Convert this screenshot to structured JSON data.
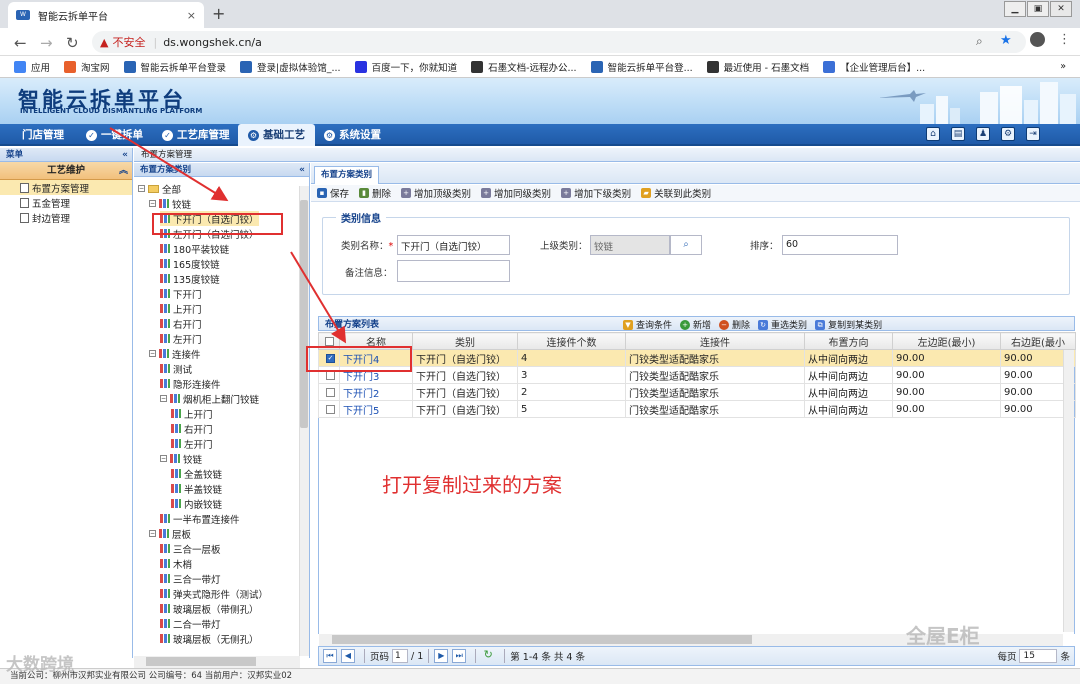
{
  "browser": {
    "tab_title": "智能云拆单平台",
    "tab_close": "×",
    "new_tab": "+",
    "insecure_label": "不安全",
    "url": "ds.wongshek.cn/a",
    "bookmarks": [
      {
        "label": "应用",
        "icon": "apps-icon",
        "color": "#4285f4"
      },
      {
        "label": "淘宝网",
        "icon": "taobao-icon",
        "color": "#e8602c"
      },
      {
        "label": "智能云拆单平台登录",
        "icon": "site-icon",
        "color": "#2a64b4"
      },
      {
        "label": "登录|虚拟体验馆_...",
        "icon": "site-icon",
        "color": "#2a64b4"
      },
      {
        "label": "百度一下，你就知道",
        "icon": "baidu-icon",
        "color": "#2932e1"
      },
      {
        "label": "石墨文档-远程办公...",
        "icon": "shimo-icon",
        "color": "#333333"
      },
      {
        "label": "智能云拆单平台登...",
        "icon": "site-icon",
        "color": "#2a64b4"
      },
      {
        "label": "最近使用 - 石墨文档",
        "icon": "shimo-icon",
        "color": "#333333"
      },
      {
        "label": "【企业管理后台】...",
        "icon": "shield-icon",
        "color": "#3b6fd6"
      }
    ],
    "bookmark_more": "»"
  },
  "app": {
    "title": "智能云拆单平台",
    "subtitle": "INTELLIGENT CLOUD DISMANTLING PLATFORM",
    "nav": [
      "门店管理",
      "一键拆单",
      "工艺库管理",
      "基础工艺",
      "系统设置"
    ],
    "active_nav": "基础工艺"
  },
  "menu": {
    "header": "菜单",
    "group": "工艺维护",
    "items": [
      "布置方案管理",
      "五金管理",
      "封边管理"
    ],
    "selected": "布置方案管理"
  },
  "breadcrumb": "布置方案管理",
  "tree": {
    "header": "布置方案类别",
    "nodes": [
      {
        "label": "全部",
        "level": 0,
        "kind": "folder"
      },
      {
        "label": "铰链",
        "level": 1,
        "kind": "group"
      },
      {
        "label": "下开门（自选门铰）",
        "level": 2,
        "kind": "leaf",
        "selected": true
      },
      {
        "label": "左开门（自选门铰）",
        "level": 2,
        "kind": "leaf"
      },
      {
        "label": "180平装铰链",
        "level": 2,
        "kind": "leaf"
      },
      {
        "label": "165度铰链",
        "level": 2,
        "kind": "leaf"
      },
      {
        "label": "135度铰链",
        "level": 2,
        "kind": "leaf"
      },
      {
        "label": "下开门",
        "level": 2,
        "kind": "leaf"
      },
      {
        "label": "上开门",
        "level": 2,
        "kind": "leaf"
      },
      {
        "label": "右开门",
        "level": 2,
        "kind": "leaf"
      },
      {
        "label": "左开门",
        "level": 2,
        "kind": "leaf"
      },
      {
        "label": "连接件",
        "level": 1,
        "kind": "group"
      },
      {
        "label": "测试",
        "level": 2,
        "kind": "leaf"
      },
      {
        "label": "隐形连接件",
        "level": 2,
        "kind": "leaf"
      },
      {
        "label": "烟机柜上翻门铰链",
        "level": 2,
        "kind": "group"
      },
      {
        "label": "上开门",
        "level": 3,
        "kind": "leaf"
      },
      {
        "label": "右开门",
        "level": 3,
        "kind": "leaf"
      },
      {
        "label": "左开门",
        "level": 3,
        "kind": "leaf"
      },
      {
        "label": "铰链",
        "level": 2,
        "kind": "group"
      },
      {
        "label": "全盖铰链",
        "level": 3,
        "kind": "leaf"
      },
      {
        "label": "半盖铰链",
        "level": 3,
        "kind": "leaf"
      },
      {
        "label": "内嵌铰链",
        "level": 3,
        "kind": "leaf"
      },
      {
        "label": "一半布置连接件",
        "level": 2,
        "kind": "leaf"
      },
      {
        "label": "层板",
        "level": 1,
        "kind": "group"
      },
      {
        "label": "三合一层板",
        "level": 2,
        "kind": "leaf"
      },
      {
        "label": "木梢",
        "level": 2,
        "kind": "leaf"
      },
      {
        "label": "三合一带灯",
        "level": 2,
        "kind": "leaf"
      },
      {
        "label": "弹夹式隐形件（测试）",
        "level": 2,
        "kind": "leaf"
      },
      {
        "label": "玻璃层板（带侧孔）",
        "level": 2,
        "kind": "leaf"
      },
      {
        "label": "二合一带灯",
        "level": 2,
        "kind": "leaf"
      },
      {
        "label": "玻璃层板（无侧孔）",
        "level": 2,
        "kind": "leaf"
      }
    ]
  },
  "main_tab": "布置方案类别",
  "toolbar": [
    "保存",
    "删除",
    "增加顶级类别",
    "增加同级类别",
    "增加下级类别",
    "关联到此类别"
  ],
  "form": {
    "legend": "类别信息",
    "name_label": "类别名称：",
    "required_mark": "*",
    "name_value": "下开门（自选门铰）",
    "parent_label": "上级类别：",
    "parent_value": "铰链",
    "order_label": "排序：",
    "order_value": "60",
    "note_label": "备注信息："
  },
  "grid": {
    "title": "布置方案列表",
    "tools": [
      "查询条件",
      "新增",
      "删除",
      "重选类别",
      "复制到某类别"
    ],
    "columns": [
      "名称",
      "类别",
      "连接件个数",
      "连接件",
      "布置方向",
      "左边距(最小)",
      "右边距(最小"
    ],
    "rows": [
      {
        "name": "下开门4",
        "category": "下开门（自选门铰）",
        "count": "4",
        "connector": "门铰类型适配酷家乐",
        "direction": "从中间向两边",
        "left": "90.00",
        "right": "90.00",
        "checked": true
      },
      {
        "name": "下开门3",
        "category": "下开门（自选门铰）",
        "count": "3",
        "connector": "门铰类型适配酷家乐",
        "direction": "从中间向两边",
        "left": "90.00",
        "right": "90.00",
        "checked": false
      },
      {
        "name": "下开门2",
        "category": "下开门（自选门铰）",
        "count": "2",
        "connector": "门铰类型适配酷家乐",
        "direction": "从中间向两边",
        "left": "90.00",
        "right": "90.00",
        "checked": false
      },
      {
        "name": "下开门5",
        "category": "下开门（自选门铰）",
        "count": "5",
        "connector": "门铰类型适配酷家乐",
        "direction": "从中间向两边",
        "left": "90.00",
        "right": "90.00",
        "checked": false
      }
    ]
  },
  "pager": {
    "page_label": "页码",
    "page_value": "1",
    "total_pages": "/ 1",
    "summary": "第 1-4 条  共 4 条",
    "per_page_label": "每页",
    "per_page_value": "15",
    "per_page_suffix": "条"
  },
  "status": "当前公司：柳州市汉邦实业有限公司    公司编号：64    当前用户：汉邦实业02",
  "annotation": "打开复制过来的方案",
  "watermarks": [
    "大数跨境",
    "全屋E柜"
  ]
}
